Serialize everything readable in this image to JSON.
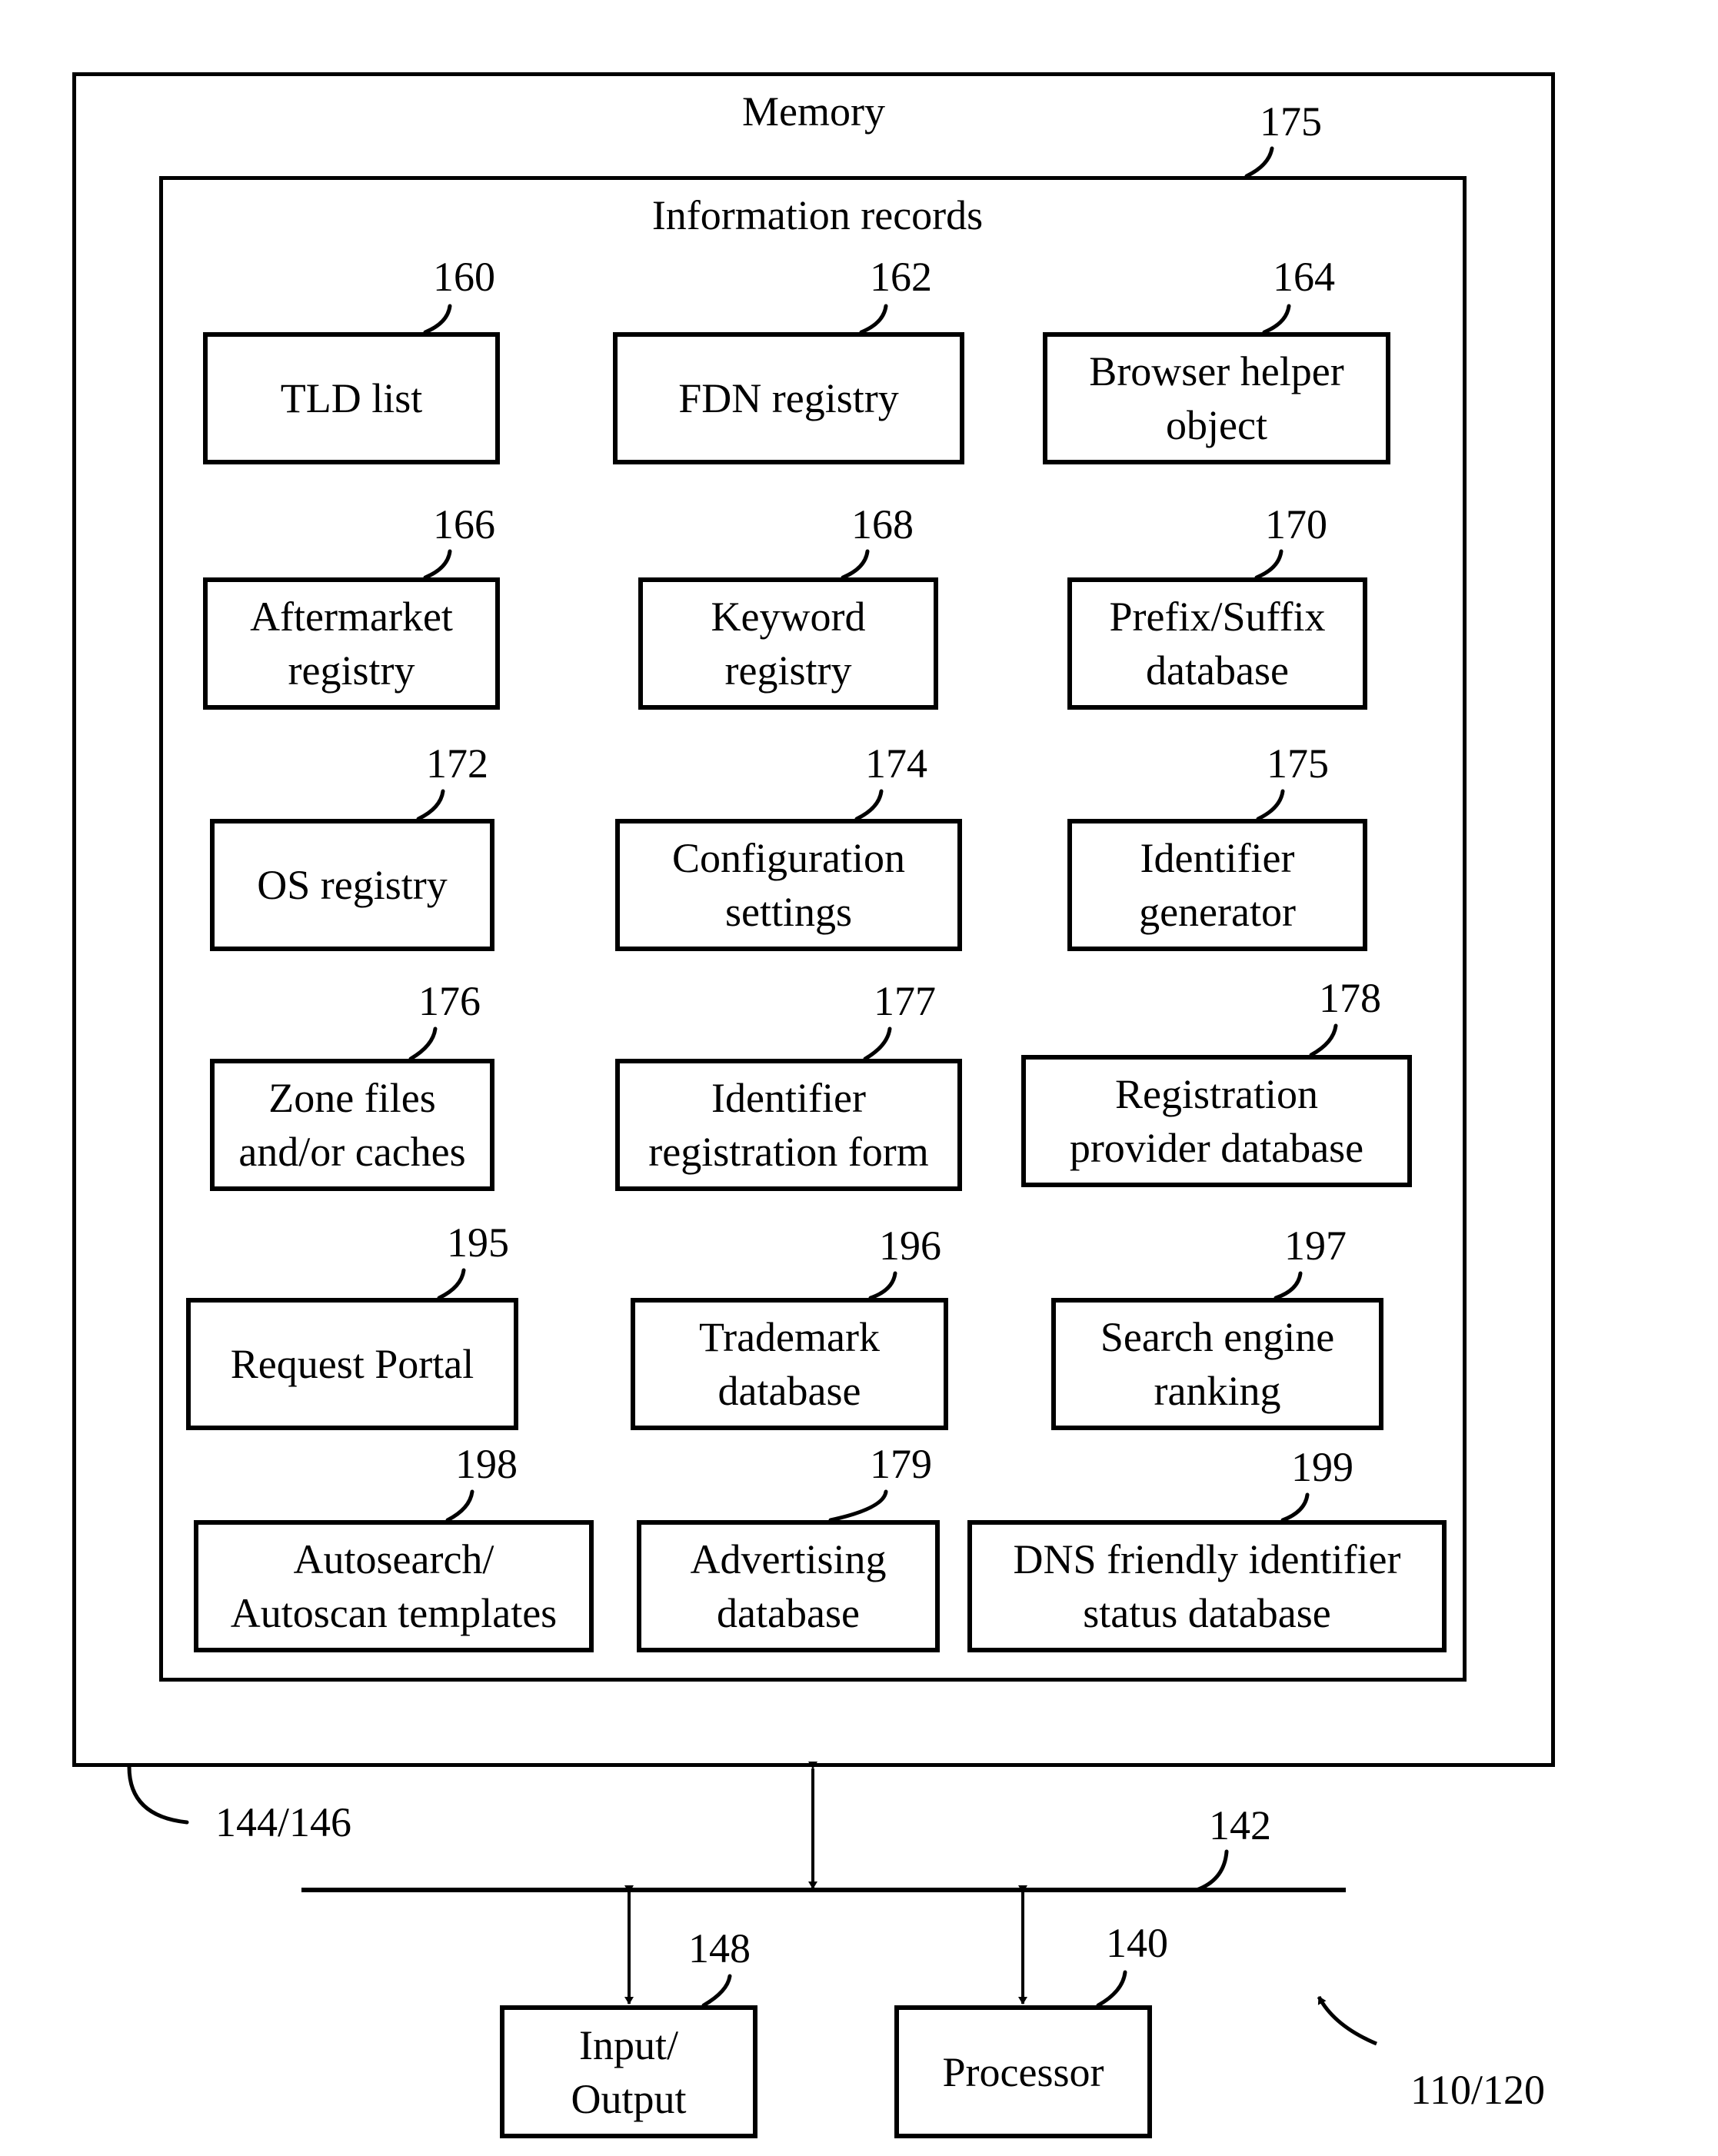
{
  "memory": {
    "title": "Memory",
    "ref": "144/146"
  },
  "information_records": {
    "title": "Information records",
    "ref": "175"
  },
  "records": [
    {
      "id": "tld-list",
      "label": "TLD list",
      "ref": "160"
    },
    {
      "id": "fdn-registry",
      "label": "FDN registry",
      "ref": "162"
    },
    {
      "id": "browser-helper-object",
      "label": "Browser helper\nobject",
      "ref": "164"
    },
    {
      "id": "aftermarket-registry",
      "label": "Aftermarket\nregistry",
      "ref": "166"
    },
    {
      "id": "keyword-registry",
      "label": "Keyword\nregistry",
      "ref": "168"
    },
    {
      "id": "prefix-suffix-database",
      "label": "Prefix/Suffix\ndatabase",
      "ref": "170"
    },
    {
      "id": "os-registry",
      "label": "OS registry",
      "ref": "172"
    },
    {
      "id": "configuration-settings",
      "label": "Configuration\nsettings",
      "ref": "174"
    },
    {
      "id": "identifier-generator",
      "label": "Identifier\ngenerator",
      "ref": "175"
    },
    {
      "id": "zone-files-caches",
      "label": "Zone files\nand/or caches",
      "ref": "176"
    },
    {
      "id": "identifier-registration-form",
      "label": "Identifier\nregistration form",
      "ref": "177"
    },
    {
      "id": "registration-provider-database",
      "label": "Registration\nprovider database",
      "ref": "178"
    },
    {
      "id": "request-portal",
      "label": "Request Portal",
      "ref": "195"
    },
    {
      "id": "trademark-database",
      "label": "Trademark\ndatabase",
      "ref": "196"
    },
    {
      "id": "search-engine-ranking",
      "label": "Search engine\nranking",
      "ref": "197"
    },
    {
      "id": "autosearch-autoscan-templates",
      "label": "Autosearch/\nAutoscan templates",
      "ref": "198"
    },
    {
      "id": "advertising-database",
      "label": "Advertising\ndatabase",
      "ref": "179"
    },
    {
      "id": "dns-friendly-identifier-status-database",
      "label": "DNS friendly identifier\nstatus database",
      "ref": "199"
    }
  ],
  "bus": {
    "ref": "142"
  },
  "io": {
    "label": "Input/\nOutput",
    "ref": "148"
  },
  "processor": {
    "label": "Processor",
    "ref": "140"
  },
  "system": {
    "ref": "110/120"
  }
}
